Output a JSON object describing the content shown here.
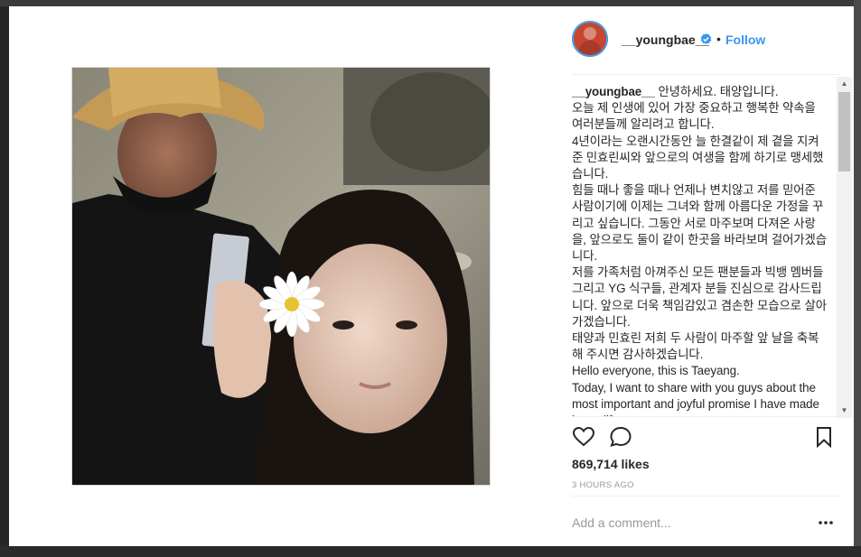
{
  "post": {
    "username": "__youngbae__",
    "verified_icon": "verified-badge-icon",
    "separator": "•",
    "follow_label": "Follow",
    "caption": {
      "username": "__youngbae__",
      "text": " 안녕하세요. 태양입니다.\n오늘 제 인생에 있어 가장 중요하고 행복한 약속을 여러분들께 알리려고 합니다.\n4년이라는 오랜시간동안 늘 한결같이 제 곁을 지켜준 민효린씨와 앞으로의 여생을 함께 하기로 맹세했습니다.\n힘들 때나 좋을 때나 언제나 변치않고 저를 믿어준 사람이기에 이제는 그녀와 함께 아름다운 가정을 꾸리고 싶습니다. 그동안 서로 마주보며 다져온 사랑을, 앞으로도 둘이 같이 한곳을 바라보며 걸어가겠습니다.\n저를 가족처럼 아껴주신 모든 팬분들과 빅뱅 멤버들 그리고 YG 식구들, 관계자 분들 진심으로 감사드립니다. 앞으로 더욱 책임감있고 겸손한 모습으로 살아가겠습니다.\n태양과 민효린 저희 두 사람이 마주할 앞 날을 축복해 주시면 감사하겠습니다.\nHello everyone, this is Taeyang.\nToday, I want to share with you guys about the most important and joyful promise I have made in my life."
    },
    "likes": "869,714 likes",
    "timestamp": "3 HOURS AGO",
    "comment_placeholder": "Add a comment...",
    "icons": {
      "like": "heart-icon",
      "comment": "comment-icon",
      "save": "bookmark-icon",
      "more": "more-options-icon"
    },
    "colors": {
      "link": "#3897f0",
      "text": "#262626",
      "muted": "#999999"
    }
  }
}
